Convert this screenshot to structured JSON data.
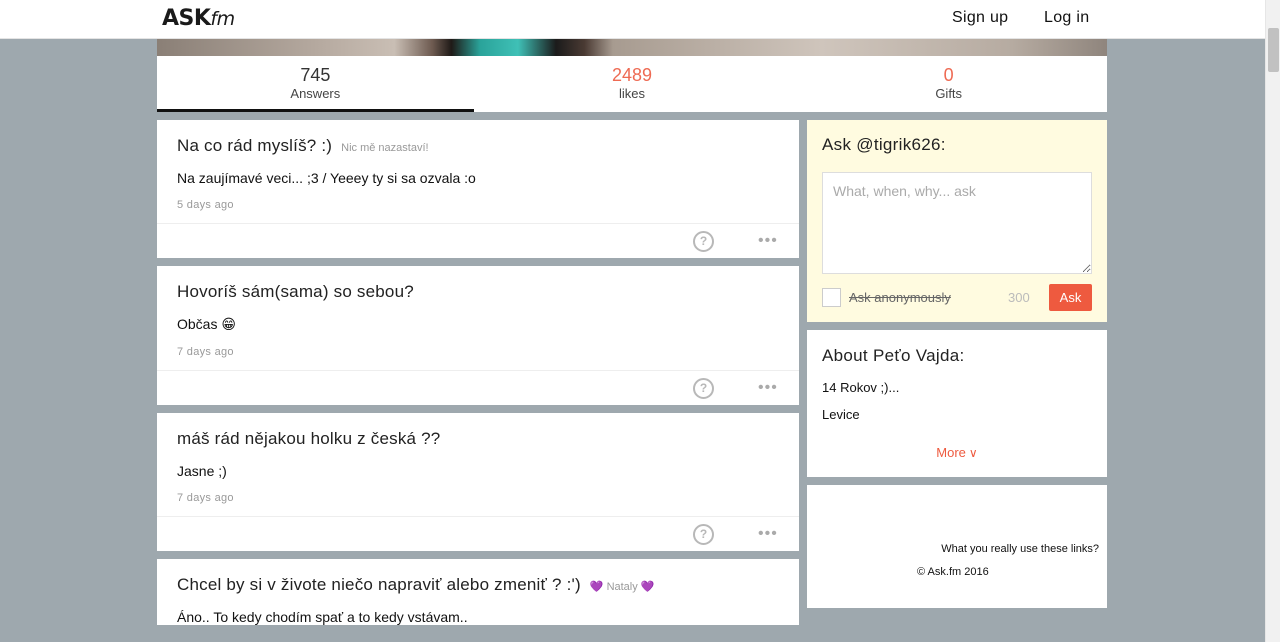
{
  "header": {
    "logo_main": "ASK",
    "logo_suffix": "fm",
    "signup_label": "Sign up",
    "login_label": "Log in"
  },
  "stats": [
    {
      "value": "745",
      "label": "Answers",
      "active": true
    },
    {
      "value": "2489",
      "label": "likes"
    },
    {
      "value": "0",
      "label": "Gifts"
    }
  ],
  "feed": [
    {
      "question": "Na co rád myslíš? :)",
      "asker": "Nic mě nazastaví!",
      "answer": "Na zaujímavé veci... ;3 / Yeeey ty si sa ozvala :o",
      "time": "5 days ago"
    },
    {
      "question": "Hovoríš sám(sama) so sebou?",
      "answer": "Občas 😁",
      "time": "7 days ago"
    },
    {
      "question": "máš rád nějakou holku z česká ??",
      "answer": "Jasne ;)",
      "time": "7 days ago"
    },
    {
      "question": "Chcel by si v živote niečo napraviť alebo zmeniť ? :')",
      "asker": "💜 Nataly 💜",
      "answer": "Áno.. To kedy chodím spať a to kedy vstávam.."
    }
  ],
  "ask": {
    "title": "Ask @tigrik626:",
    "placeholder": "What, when, why... ask",
    "anon_label": "Ask anonymously",
    "char_count": "300",
    "button_label": "Ask"
  },
  "about": {
    "title": "About Peťo Vajda:",
    "lines": [
      "14 Rokov ;)...",
      "Levice"
    ],
    "more_label": "More"
  },
  "footer": {
    "links_text": "What you really use these links?",
    "copyright": "© Ask.fm 2016"
  },
  "icons": {
    "react": "question-reaction-icon",
    "more": "ellipsis-icon",
    "chevron": "chevron-down-icon"
  },
  "colors": {
    "accent": "#ee5a3f",
    "page_bg": "#9ea8ae",
    "ask_bg": "#fffbe0"
  }
}
